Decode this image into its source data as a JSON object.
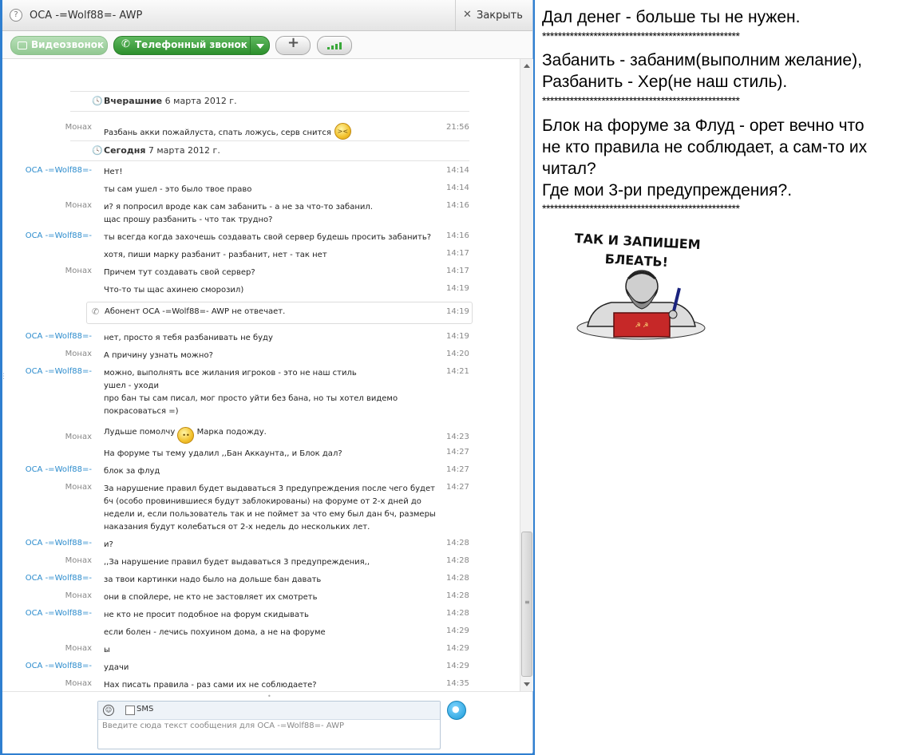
{
  "window": {
    "title": "ОСА -=Wolf88=- AWP",
    "close_label": "Закрыть"
  },
  "toolbar": {
    "video_label": "Видеозвонок",
    "call_label": "Телефонный звонок"
  },
  "chat": {
    "day1": {
      "bold": "Вчерашние",
      "date": "6 марта 2012 г."
    },
    "day2": {
      "bold": "Сегодня",
      "date": "7 марта 2012 г."
    },
    "call_notice": {
      "text": "Абонент ОСА -=Wolf88=- AWP не отвечает.",
      "time": "14:19"
    },
    "messages": [
      {
        "sender": "Монах",
        "text": "Разбань акки пожайлуста, спать ложусь, серв снится",
        "time": "21:56"
      },
      {
        "sender": "ОСА -=Wolf88=-",
        "text": "Нет!",
        "time": "14:14"
      },
      {
        "sender": "",
        "text": "ты сам ушел - это было твое право",
        "time": "14:14"
      },
      {
        "sender": "Монах",
        "text": "и? я попросил вроде как сам забанить - а не за что-то забанил.",
        "time": "14:16"
      },
      {
        "sender": "",
        "text": "щас прошу разбанить - что так трудно?",
        "time": ""
      },
      {
        "sender": "ОСА -=Wolf88=-",
        "text": "ты всегда когда захочешь создавать свой сервер будешь просить забанить?",
        "time": "14:16"
      },
      {
        "sender": "",
        "text": "хотя, пиши марку разбанит - разбанит, нет - так нет",
        "time": "14:17"
      },
      {
        "sender": "Монах",
        "text": "Причем тут создавать свой сервер?",
        "time": "14:17"
      },
      {
        "sender": "",
        "text": "Что-то ты щас ахинею сморозил)",
        "time": "14:19"
      },
      {
        "sender": "ОСА -=Wolf88=-",
        "text": "нет, просто я тебя разбанивать не буду",
        "time": "14:19"
      },
      {
        "sender": "Монах",
        "text": "А причину узнать можно?",
        "time": "14:20"
      },
      {
        "sender": "ОСА -=Wolf88=-",
        "text": "можно, выполнять все жилания игроков - это не наш стиль",
        "time": "14:21"
      },
      {
        "sender": "",
        "text": "ушел - уходи",
        "time": ""
      },
      {
        "sender": "",
        "text": "про бан ты сам писал, мог просто уйти без бана, но ты хотел видемо",
        "time": ""
      },
      {
        "sender": "",
        "text": "покрасоваться =)",
        "time": ""
      },
      {
        "sender": "Монах",
        "text_before": "Лудьше помолчу",
        "text_after": "Марка подожду.",
        "time": "14:23"
      },
      {
        "sender": "",
        "text": "На форуме ты тему удалил ,,Бан Аккаунта,, и Блок дал?",
        "time": "14:27"
      },
      {
        "sender": "ОСА -=Wolf88=-",
        "text": "блок за флуд",
        "time": "14:27"
      },
      {
        "sender": "Монах",
        "text": "За нарушение правил будет выдаваться 3 предупреждения после чего будет",
        "time": "14:27"
      },
      {
        "sender": "",
        "text": "бч (особо провинившиеся будут заблокированы) на форуме от 2-х дней до",
        "time": ""
      },
      {
        "sender": "",
        "text": "недели и, если пользователь так и не поймет за что ему был дан бч, размеры",
        "time": ""
      },
      {
        "sender": "",
        "text": "наказания будут колебаться от 2-х недель до нескольких лет.",
        "time": ""
      },
      {
        "sender": "ОСА -=Wolf88=-",
        "text": "и?",
        "time": "14:28"
      },
      {
        "sender": "Монах",
        "text": ",,За нарушение правил будет выдаваться 3 предупреждения,,",
        "time": "14:28"
      },
      {
        "sender": "ОСА -=Wolf88=-",
        "text": "за твои картинки надо было на дольше бан давать",
        "time": "14:28"
      },
      {
        "sender": "Монах",
        "text": "они в спойлере, не кто не застовляет их смотреть",
        "time": "14:28"
      },
      {
        "sender": "ОСА -=Wolf88=-",
        "text": "не кто не просит подобное на форум скидывать",
        "time": "14:28"
      },
      {
        "sender": "",
        "text": "если болен - лечись похуином дома, а не на форуме",
        "time": "14:29"
      },
      {
        "sender": "Монах",
        "text": "ы",
        "time": "14:29"
      },
      {
        "sender": "ОСА -=Wolf88=-",
        "text": "удачи",
        "time": "14:29"
      },
      {
        "sender": "Монах",
        "text": "Нах писать правила - раз сами их не соблюдаете?",
        "time": "14:35"
      }
    ]
  },
  "compose": {
    "sms_label": "SMS",
    "placeholder": "Введите сюда текст сообщения для ОСА -=Wolf88=- AWP"
  },
  "side": {
    "line1": "Дал денег - больше ты не нужен.",
    "stars": "**************************************************",
    "line2": "Забанить - забаним(выполним желание),",
    "line3": "Разбанить - Хер(не наш стиль).",
    "line4": "Блок на форуме за Флуд - орет вечно что",
    "line5": "не кто правила не соблюдает, а сам-то их",
    "line6": "читал?",
    "line7": "Где мои 3-ри предупреждения?.",
    "meme_caption": "ТАК И ЗАПИШЕМ БЛЕАТЬ!"
  },
  "colors": {
    "frame": "#2f7fd0",
    "call_green": "#2c8f2c",
    "sender_blue": "#2c8ccd",
    "sender_gray": "#888888"
  }
}
